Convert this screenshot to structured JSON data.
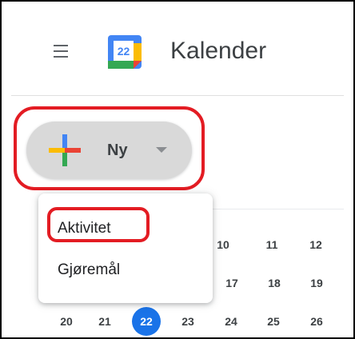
{
  "header": {
    "app_title": "Kalender",
    "logo_date": "22",
    "menu_icon": "hamburger-menu-icon"
  },
  "create": {
    "label": "Ny",
    "icon": "plus-icon",
    "dropdown_icon": "caret-down-icon"
  },
  "create_menu": {
    "items": [
      {
        "label": "Aktivitet",
        "highlighted": true
      },
      {
        "label": "Gjøremål"
      }
    ]
  },
  "mini_calendar": {
    "row_top_visible": [
      "10",
      "11",
      "12"
    ],
    "row_mid_visible": [
      "17",
      "18",
      "19"
    ],
    "row_bottom": [
      "20",
      "21",
      "22",
      "23",
      "24",
      "25",
      "26"
    ],
    "today": "22"
  },
  "colors": {
    "highlight": "#e31c23",
    "today": "#1a73e8",
    "text": "#3c4043",
    "button_bg": "#d9d9d9",
    "plus_blue": "#4285f4",
    "plus_red": "#ea4335",
    "plus_yellow": "#fbbc04",
    "plus_green": "#34a853"
  }
}
